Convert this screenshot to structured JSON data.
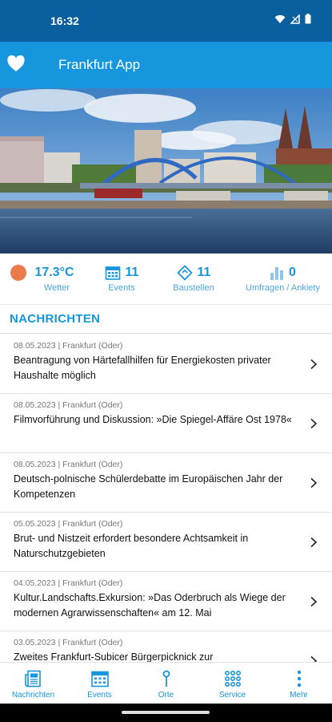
{
  "status_bar": {
    "time": "16:32"
  },
  "app_bar": {
    "title": "Frankfurt App"
  },
  "stats": [
    {
      "value": "17.3°C",
      "label": "Wetter",
      "icon": "sun-icon"
    },
    {
      "value": "11",
      "label": "Events",
      "icon": "calendar-icon"
    },
    {
      "value": "11",
      "label": "Baustellen",
      "icon": "construction-icon"
    },
    {
      "value": "0",
      "label": "Umfragen / Ankiety",
      "icon": "bar-chart-icon"
    }
  ],
  "section": {
    "title": "NACHRICHTEN"
  },
  "news": [
    {
      "meta": "08.05.2023 | Frankfurt (Oder)",
      "headline": "Beantragung von Härtefallhilfen für Energiekosten privater Haushalte möglich"
    },
    {
      "meta": "08.05.2023 | Frankfurt (Oder)",
      "headline": "Filmvorführung und Diskussion: »Die Spiegel-Affäre Ost 1978«"
    },
    {
      "meta": "08.05.2023 | Frankfurt (Oder)",
      "headline": "Deutsch-polnische Schülerdebatte im Europäischen Jahr der Kompetenzen"
    },
    {
      "meta": "05.05.2023 | Frankfurt (Oder)",
      "headline": "Brut- und Nistzeit erfordert besondere Achtsamkeit in Naturschutzgebieten"
    },
    {
      "meta": "04.05.2023 | Frankfurt (Oder)",
      "headline": "Kultur.Landschafts.Exkursion: »Das Oderbruch als Wiege der modernen Agrarwissenschaften« am 12. Mai"
    },
    {
      "meta": "03.05.2023 | Frankfurt (Oder)",
      "headline": "Zweites Frankfurt-Subicer Bürgerpicknick zur"
    }
  ],
  "bottom_nav": [
    {
      "label": "Nachrichten",
      "icon": "newspaper-icon"
    },
    {
      "label": "Events",
      "icon": "calendar-icon"
    },
    {
      "label": "Orte",
      "icon": "pin-icon"
    },
    {
      "label": "Service",
      "icon": "grid-icon"
    },
    {
      "label": "Mehr",
      "icon": "more-vertical-icon"
    }
  ],
  "colors": {
    "primary": "#1596dd",
    "status_bar": "#0a5f9e",
    "weather_sun": "#ec7b4b"
  }
}
